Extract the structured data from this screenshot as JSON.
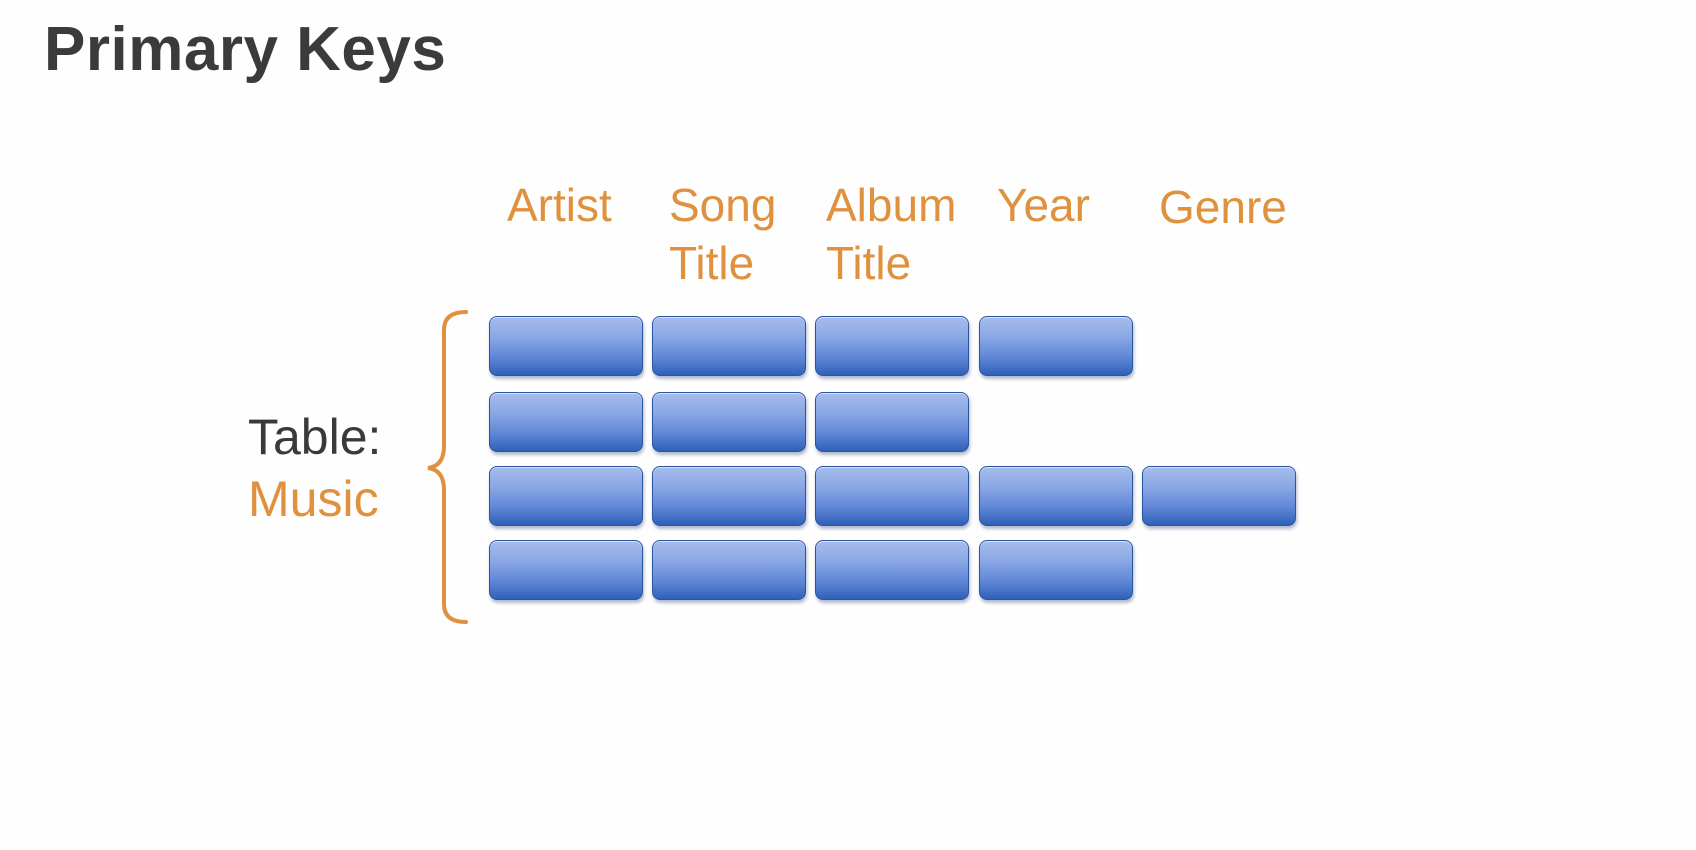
{
  "slide": {
    "title": "Primary Keys"
  },
  "diagram": {
    "columns": [
      {
        "label": "Artist"
      },
      {
        "label": "Song\nTitle"
      },
      {
        "label": "Album\nTitle"
      },
      {
        "label": "Year"
      },
      {
        "label": "Genre"
      }
    ],
    "table_label": {
      "prefix": "Table:",
      "name": "Music"
    },
    "rows": [
      {
        "filled_columns": 4
      },
      {
        "filled_columns": 3
      },
      {
        "filled_columns": 5
      },
      {
        "filled_columns": 4
      }
    ],
    "colors": {
      "accent": "#e0913e",
      "text": "#3b3b3b",
      "cell": "#5f86d6"
    }
  }
}
